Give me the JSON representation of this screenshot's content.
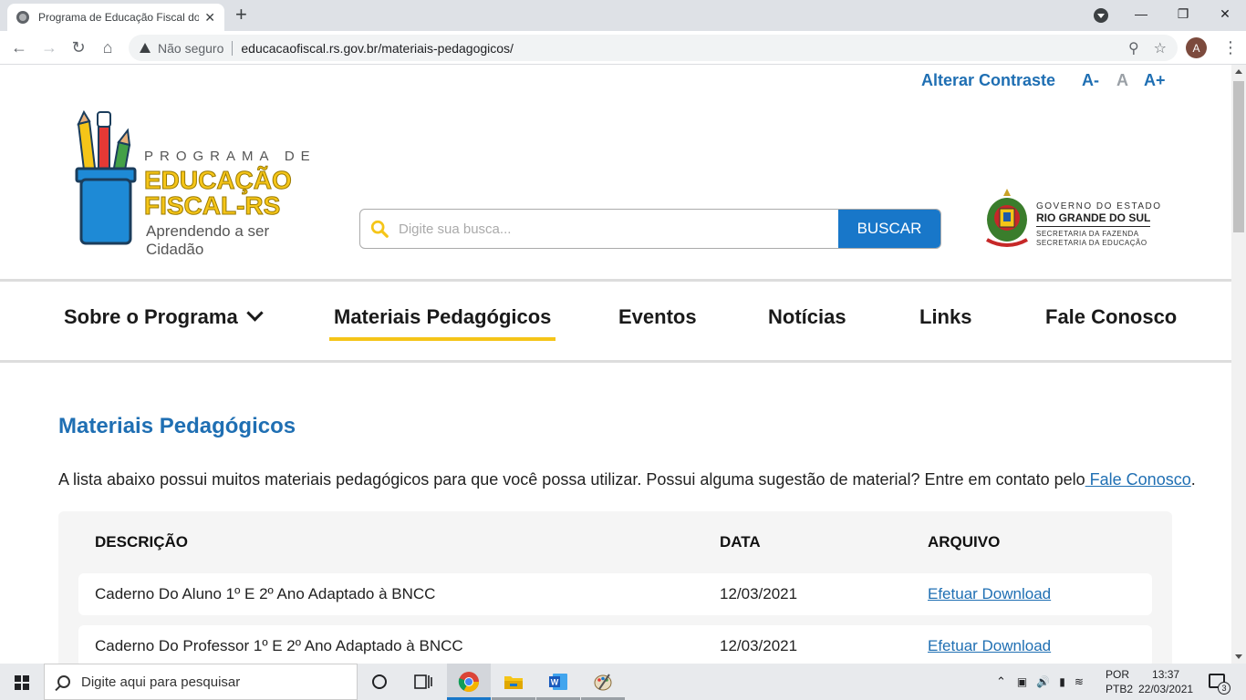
{
  "browser": {
    "tab_title": "Programa de Educação Fiscal do",
    "tab_close": "✕",
    "new_tab": "+",
    "not_secure": "Não seguro",
    "url": "educacaofiscal.rs.gov.br/materiais-pedagogicos/",
    "profile_initial": "A",
    "window_minimize": "—",
    "window_restore": "❐",
    "window_close": "✕"
  },
  "accessibility": {
    "contrast": "Alterar Contraste",
    "font_decrease": "A-",
    "font_default": "A",
    "font_increase": "A+"
  },
  "logo": {
    "line1": "PROGRAMA DE",
    "line2": "EDUCAÇÃO",
    "line3": "FISCAL-RS",
    "line4": "Aprendendo a ser Cidadão"
  },
  "search": {
    "placeholder": "Digite sua busca...",
    "button": "BUSCAR"
  },
  "government": {
    "line1": "GOVERNO DO ESTADO",
    "line2": "RIO GRANDE DO SUL",
    "line3": "SECRETARIA DA FAZENDA",
    "line4": "SECRETARIA DA EDUCAÇÃO"
  },
  "nav": {
    "items": [
      {
        "label": "Sobre o Programa"
      },
      {
        "label": "Materiais Pedagógicos"
      },
      {
        "label": "Eventos"
      },
      {
        "label": "Notícias"
      },
      {
        "label": "Links"
      },
      {
        "label": "Fale Conosco"
      }
    ]
  },
  "main": {
    "title": "Materiais Pedagógicos",
    "intro_text": "A lista abaixo possui muitos materiais pedagógicos para que você possa utilizar. Possui alguma sugestão de material? Entre em contato pelo",
    "intro_link": " Fale Conosco",
    "intro_end": "."
  },
  "table": {
    "headers": {
      "description": "DESCRIÇÃO",
      "date": "DATA",
      "file": "ARQUIVO"
    },
    "rows": [
      {
        "description": "Caderno Do Aluno 1º E 2º Ano Adaptado à BNCC",
        "date": "12/03/2021",
        "file": "Efetuar Download"
      },
      {
        "description": "Caderno Do Professor 1º E 2º Ano Adaptado à BNCC",
        "date": "12/03/2021",
        "file": "Efetuar Download"
      }
    ]
  },
  "taskbar": {
    "search_placeholder": "Digite aqui para pesquisar",
    "lang1": "POR",
    "lang2": "PTB2",
    "time": "13:37",
    "date": "22/03/2021",
    "notifications": "3"
  },
  "colors": {
    "brand_blue": "#1f6fb3",
    "button_blue": "#1877c9",
    "accent_yellow": "#f5c518"
  }
}
